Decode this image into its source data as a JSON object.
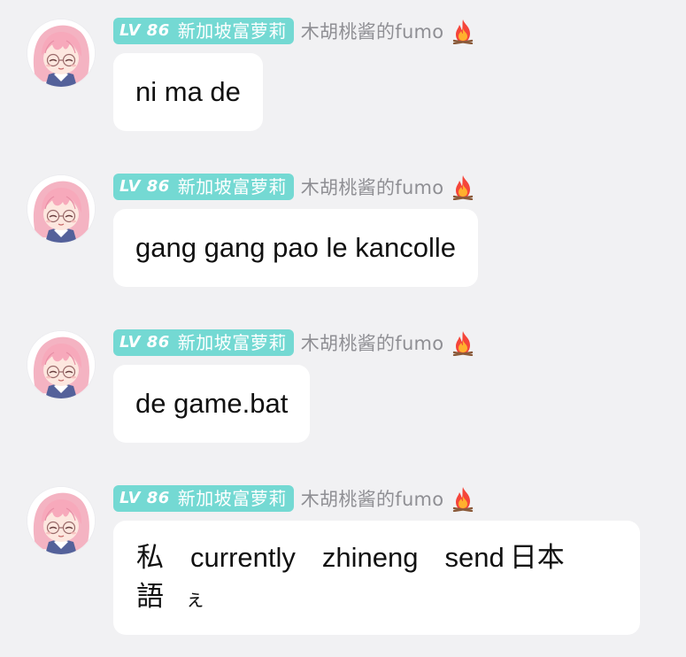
{
  "messages": [
    {
      "level": "LV 86",
      "title": "新加坡富萝莉",
      "nickname": "木胡桃酱的fumo",
      "text": "ni ma de"
    },
    {
      "level": "LV 86",
      "title": "新加坡富萝莉",
      "nickname": "木胡桃酱的fumo",
      "text": "gang gang pao le kancolle"
    },
    {
      "level": "LV 86",
      "title": "新加坡富萝莉",
      "nickname": "木胡桃酱的fumo",
      "text": "de game.bat"
    },
    {
      "level": "LV 86",
      "title": "新加坡富萝莉",
      "nickname": "木胡桃酱的fumo",
      "words": [
        "私",
        "currently",
        "zhineng",
        "send",
        "日本",
        "語",
        "ぇ"
      ]
    }
  ],
  "colors": {
    "background": "#f1f1f3",
    "bubble": "#ffffff",
    "badge": "#74d9d3",
    "nickname": "#8f8f94",
    "text": "#111111"
  },
  "icons": {
    "avatar": "pink-hair-anime-avatar",
    "flair": "fire-icon"
  }
}
